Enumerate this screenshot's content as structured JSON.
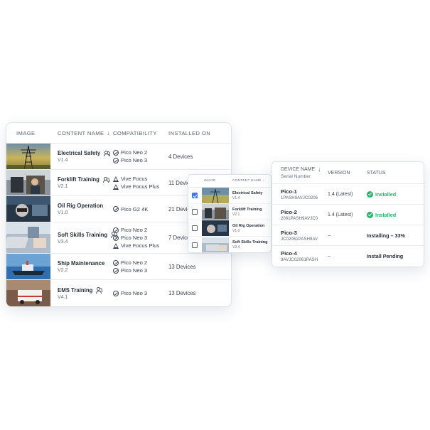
{
  "main": {
    "headers": {
      "image": "IMAGE",
      "content_name": "CONTENT NAME",
      "compatibility": "COMPATIBILITY",
      "installed_on": "INSTALLED ON"
    },
    "rows": [
      {
        "name": "Electrical Safety",
        "version": "V1.4",
        "compat": [
          "Pico Neo 2",
          "Pico Neo 3"
        ],
        "installed": "4 Devices"
      },
      {
        "name": "Forklift Training",
        "version": "V2.1",
        "compat": [
          "Vive Focus",
          "Vive Focus Plus"
        ],
        "installed": "11 Devices"
      },
      {
        "name": "Oil Rig Operation",
        "version": "V1.0",
        "compat": [
          "Pico G2 4K"
        ],
        "installed": "21 Devices"
      },
      {
        "name": "Soft Skills Training",
        "version": "V3.4",
        "compat": [
          "Pico Neo 2",
          "Pico Neo 3",
          "Vive Focus Plus"
        ],
        "installed": "7 Devices"
      },
      {
        "name": "Ship Maintenance",
        "version": "V2.2",
        "compat": [
          "Pico Neo 2",
          "Pico Neo 3"
        ],
        "installed": "13 Devices"
      },
      {
        "name": "EMS Training",
        "version": "V4.1",
        "compat": [
          "Pico Neo 3"
        ],
        "installed": "13 Devices"
      }
    ]
  },
  "picker": {
    "headers": {
      "image": "IMAGE",
      "content_name": "CONTENT NAME"
    },
    "rows": [
      {
        "name": "Electrical Safety",
        "version": "V1.4",
        "checked": true
      },
      {
        "name": "Forklift Training",
        "version": "V2.1",
        "checked": false
      },
      {
        "name": "Oil Rig Operation",
        "version": "V1.0",
        "checked": false
      },
      {
        "name": "Soft Skills Training",
        "version": "V3.4",
        "checked": false
      }
    ]
  },
  "devices": {
    "headers": {
      "device_name": "DEVICE NAME",
      "serial_number": "Serial Number",
      "version": "VERSION",
      "status": "STATUS"
    },
    "rows": [
      {
        "name": "Pico-1",
        "serial": "1PASH9AVJC0206",
        "version": "1.4 (Latest)",
        "status": "Installed",
        "installed": true
      },
      {
        "name": "Pico-2",
        "serial": "2061PASH9AVJC0",
        "version": "1.4 (Latest)",
        "status": "Installed",
        "installed": true
      },
      {
        "name": "Pico-3",
        "serial": "JC02061PASH9AV",
        "version": "–",
        "status": "Installing – 33%",
        "installed": false
      },
      {
        "name": "Pico-4",
        "serial": "9AVJC02061PASH",
        "version": "–",
        "status": "Install Pending",
        "installed": false
      }
    ]
  },
  "colors": {
    "accent": "#3b7ee8",
    "success": "#27b36a"
  }
}
